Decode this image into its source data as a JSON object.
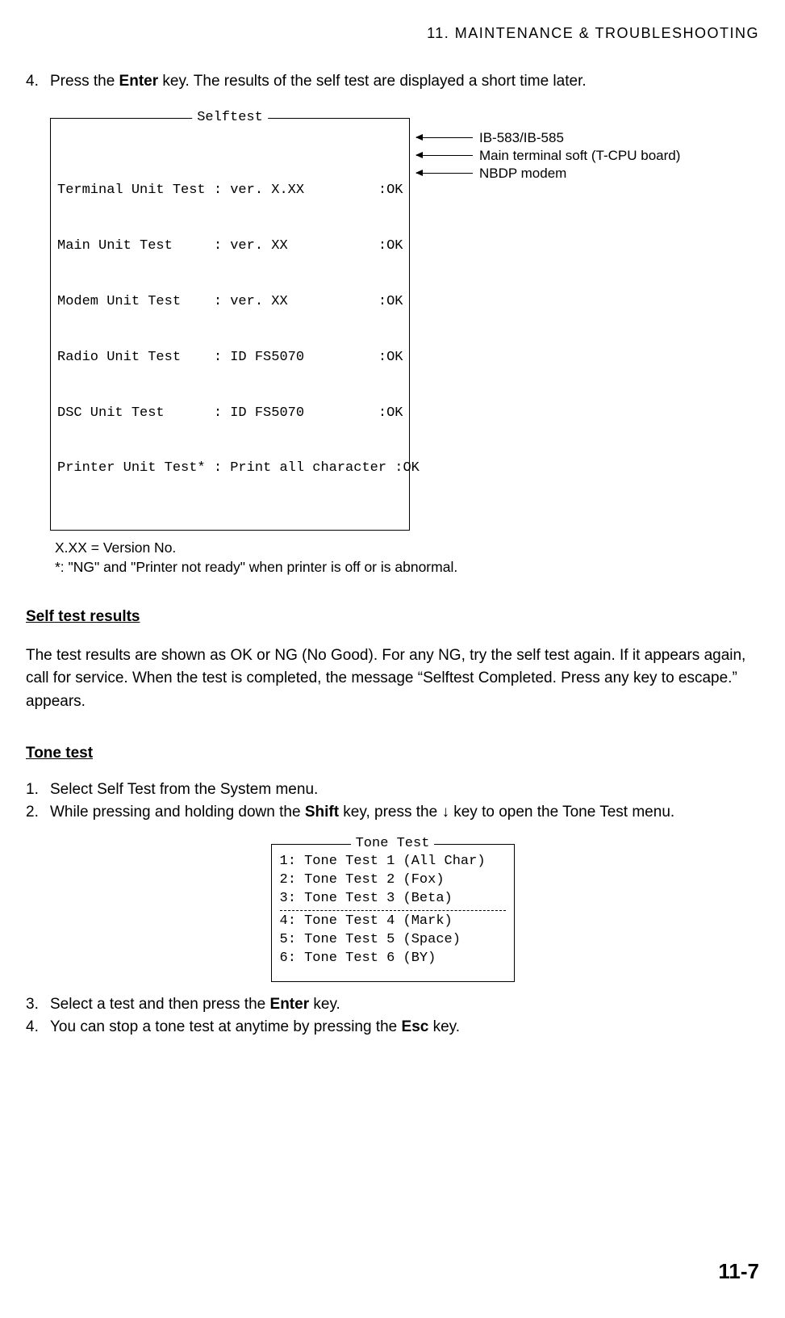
{
  "header": "11.  MAINTENANCE  &  TROUBLESHOOTING",
  "step4": {
    "num": "4.",
    "pre": "Press the ",
    "bold": "Enter",
    "post": " key. The results of the self test are displayed a short time later."
  },
  "selftest": {
    "title": "Selftest",
    "lines": [
      "Terminal Unit Test : ver. X.XX         :OK",
      "Main Unit Test     : ver. XX           :OK",
      "Modem Unit Test    : ver. XX           :OK",
      "Radio Unit Test    : ID FS5070         :OK",
      "DSC Unit Test      : ID FS5070         :OK",
      "Printer Unit Test* : Print all character :OK"
    ],
    "callouts": [
      "IB-583/IB-585",
      "Main terminal soft (T-CPU board)",
      "NBDP modem"
    ]
  },
  "notes": {
    "line1": "X.XX = Version No.",
    "line2": "*: \"NG\"  and \"Printer not ready\" when printer is off or is abnormal."
  },
  "selfResults": {
    "heading": "Self test results",
    "para": "The test results are shown as OK or NG (No Good). For any NG, try the self test again. If it appears again, call for service. When the test is completed, the message “Selftest Completed. Press any key to escape.” appears."
  },
  "toneTest": {
    "heading": "Tone test",
    "step1": {
      "num": "1.",
      "text": "Select Self Test from the System menu."
    },
    "step2": {
      "num": "2.",
      "pre": "While pressing and holding down the ",
      "bold": "Shift",
      "mid": " key, press the ↓ key to open the Tone Test menu."
    },
    "boxTitle": "Tone Test",
    "group1": [
      "1: Tone Test 1 (All Char)",
      "2: Tone Test 2 (Fox)",
      "3: Tone Test 3 (Beta)"
    ],
    "group2": [
      "4: Tone Test 4 (Mark)",
      "5: Tone Test 5 (Space)",
      "6: Tone Test 6 (BY)"
    ],
    "step3": {
      "num": "3.",
      "pre": "Select a test and then press the ",
      "bold": "Enter",
      "post": " key."
    },
    "step4": {
      "num": "4.",
      "pre": "You can stop a tone test at anytime by pressing the ",
      "bold": "Esc",
      "post": " key."
    }
  },
  "pageNumber": "11-7"
}
